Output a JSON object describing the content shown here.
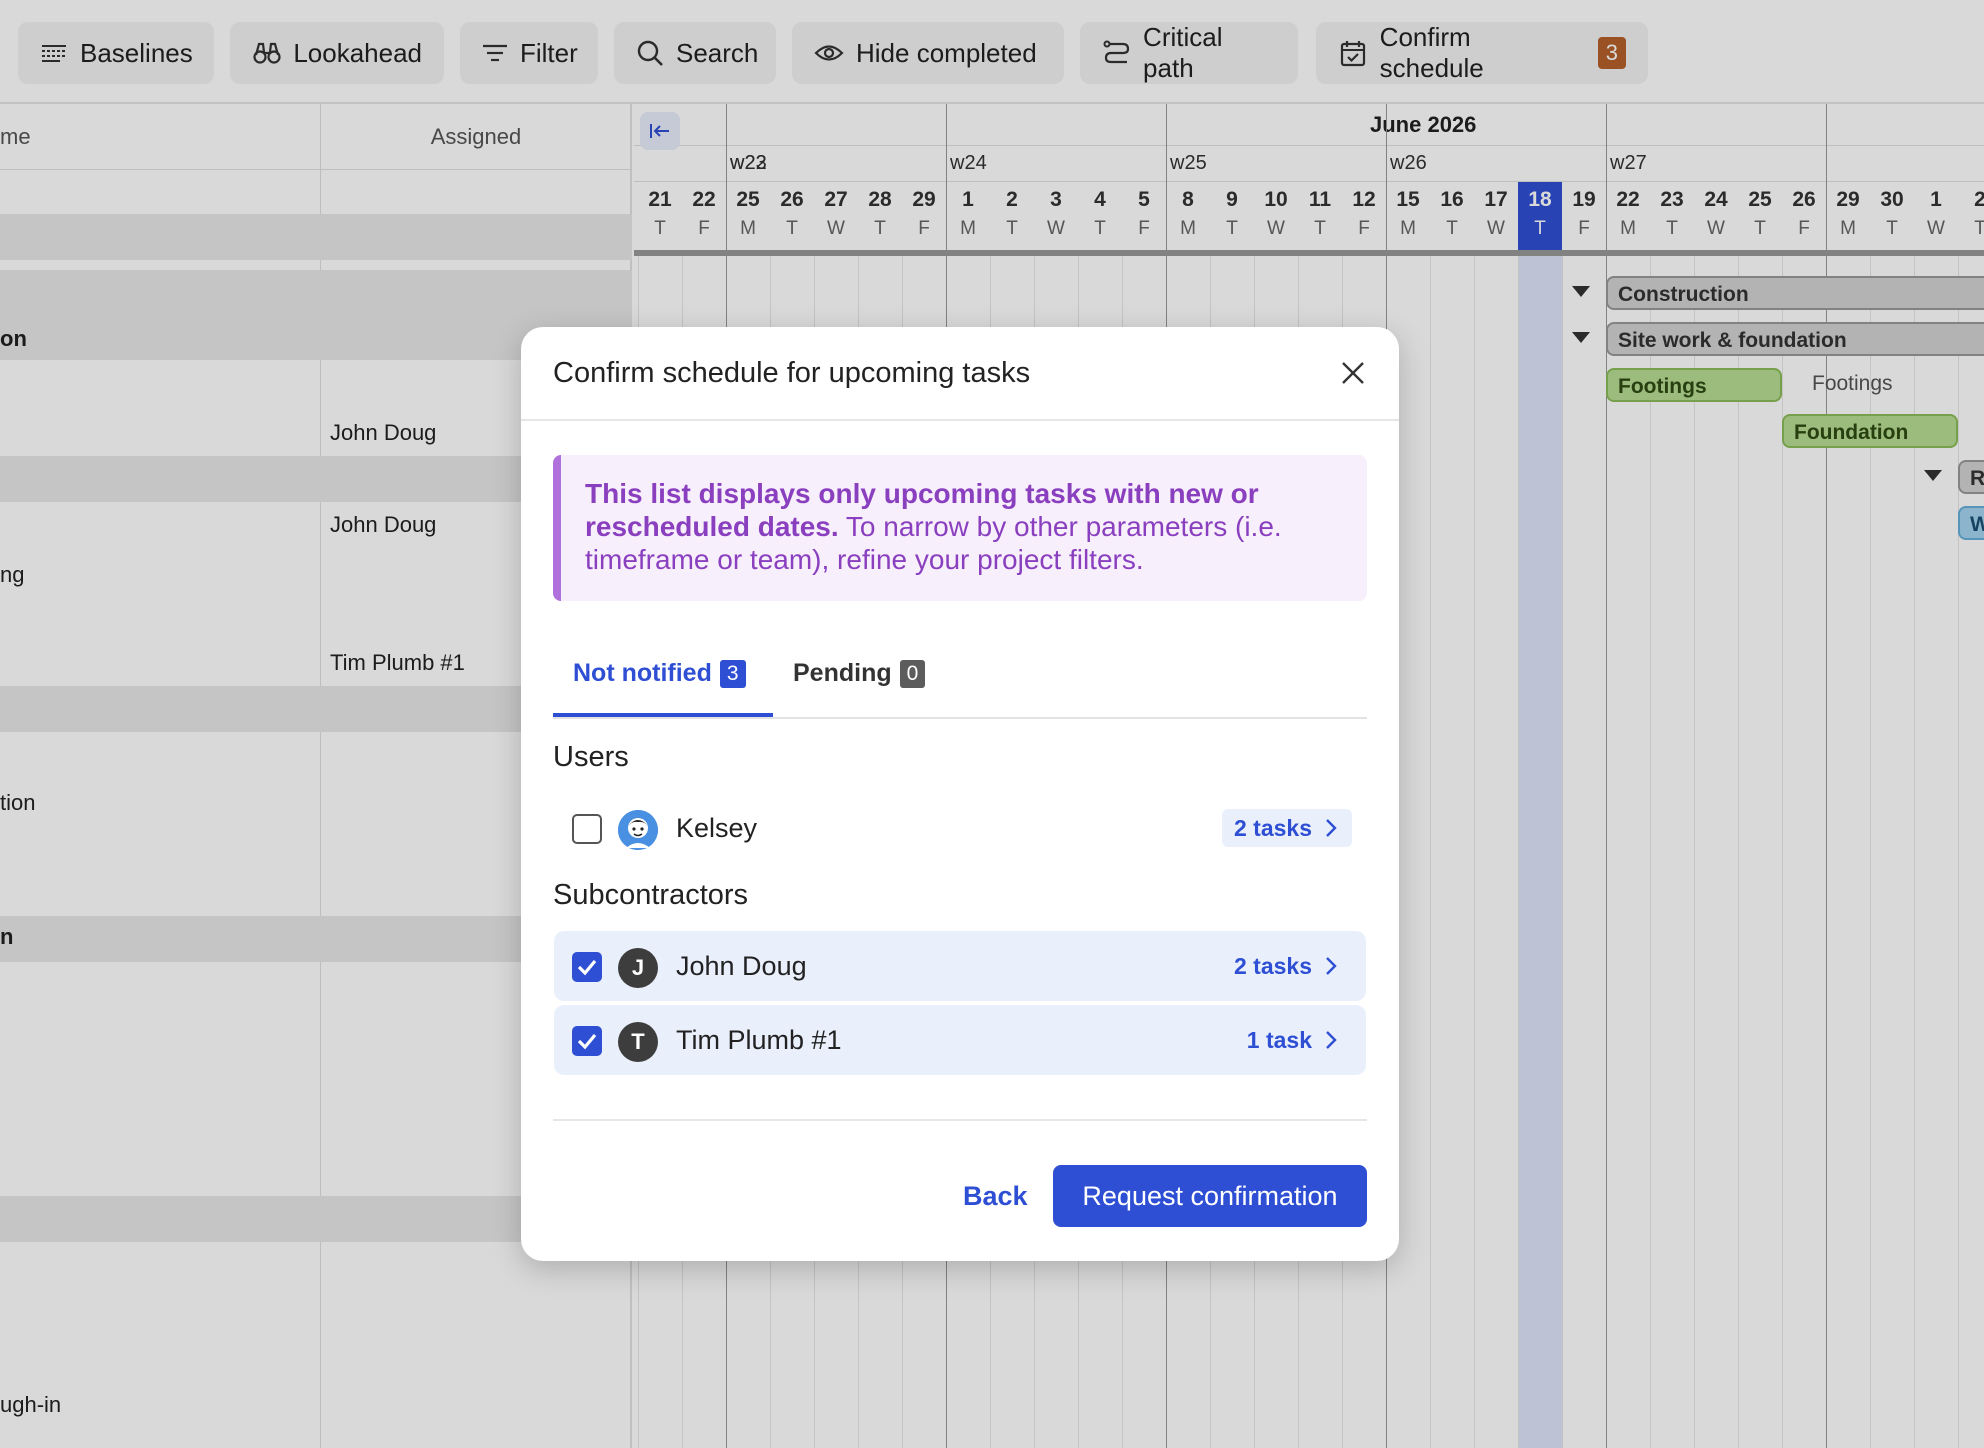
{
  "toolbar": {
    "buttons": [
      {
        "label": "Baselines",
        "icon": "baselines-icon"
      },
      {
        "label": "Lookahead",
        "icon": "binoculars-icon"
      },
      {
        "label": "Filter",
        "icon": "filter-icon"
      },
      {
        "label": "Search",
        "icon": "search-icon"
      },
      {
        "label": "Hide completed",
        "icon": "eye-icon"
      },
      {
        "label": "Critical path",
        "icon": "critical-path-icon"
      },
      {
        "label": "Confirm schedule",
        "icon": "calendar-check-icon",
        "badge": "3"
      }
    ]
  },
  "grid": {
    "col_name_header": "me",
    "col_assigned_header": "Assigned",
    "rows": [
      {
        "name": "on",
        "assigned": ""
      },
      {
        "name": "",
        "assigned": "John Doug"
      },
      {
        "name": "",
        "assigned": "John Doug"
      },
      {
        "name": "ng",
        "assigned": ""
      },
      {
        "name": "",
        "assigned": "Tim Plumb #1"
      },
      {
        "name": "tion",
        "assigned": ""
      },
      {
        "name": "n",
        "assigned": ""
      },
      {
        "name": "ugh-in",
        "assigned": ""
      }
    ]
  },
  "gantt": {
    "month": "June 2026",
    "weeks": [
      "w22",
      "w23",
      "w24",
      "w25",
      "w26",
      "w27"
    ],
    "days": [
      {
        "n": "21",
        "w": "T"
      },
      {
        "n": "22",
        "w": "F"
      },
      {
        "n": "25",
        "w": "M"
      },
      {
        "n": "26",
        "w": "T"
      },
      {
        "n": "27",
        "w": "W"
      },
      {
        "n": "28",
        "w": "T"
      },
      {
        "n": "29",
        "w": "F"
      },
      {
        "n": "1",
        "w": "M"
      },
      {
        "n": "2",
        "w": "T"
      },
      {
        "n": "3",
        "w": "W"
      },
      {
        "n": "4",
        "w": "T"
      },
      {
        "n": "5",
        "w": "F"
      },
      {
        "n": "8",
        "w": "M"
      },
      {
        "n": "9",
        "w": "T"
      },
      {
        "n": "10",
        "w": "W"
      },
      {
        "n": "11",
        "w": "T"
      },
      {
        "n": "12",
        "w": "F"
      },
      {
        "n": "15",
        "w": "M"
      },
      {
        "n": "16",
        "w": "T"
      },
      {
        "n": "17",
        "w": "W"
      },
      {
        "n": "18",
        "w": "T"
      },
      {
        "n": "19",
        "w": "F"
      },
      {
        "n": "22",
        "w": "M"
      },
      {
        "n": "23",
        "w": "T"
      },
      {
        "n": "24",
        "w": "W"
      },
      {
        "n": "25",
        "w": "T"
      },
      {
        "n": "26",
        "w": "F"
      },
      {
        "n": "29",
        "w": "M"
      },
      {
        "n": "30",
        "w": "T"
      },
      {
        "n": "1",
        "w": "W"
      },
      {
        "n": "2",
        "w": "T"
      }
    ],
    "today_index": 20,
    "bars": {
      "construction": "Construction",
      "site_work": "Site work & foundation",
      "footings": "Footings",
      "footings_label": "Footings",
      "foundation": "Foundation",
      "r_partial": "R",
      "w_partial": "W"
    }
  },
  "modal": {
    "title": "Confirm schedule for upcoming tasks",
    "notice_bold": "This list displays only upcoming tasks with new or rescheduled dates.",
    "notice_rest": " To narrow by other parameters (i.e. timeframe or team), refine your project filters.",
    "tabs": [
      {
        "label": "Not notified",
        "count": "3"
      },
      {
        "label": "Pending",
        "count": "0"
      }
    ],
    "users_title": "Users",
    "users": [
      {
        "name": "Kelsey",
        "tasks": "2 tasks",
        "checked": false
      }
    ],
    "subs_title": "Subcontractors",
    "subcontractors": [
      {
        "name": "John Doug",
        "initial": "J",
        "tasks": "2 tasks",
        "checked": true
      },
      {
        "name": "Tim Plumb #1",
        "initial": "T",
        "tasks": "1 task",
        "checked": true
      }
    ],
    "back_label": "Back",
    "primary_label": "Request confirmation"
  },
  "colors": {
    "accent": "#2e4fd4",
    "notice_text": "#8a3fbf",
    "badge_orange": "#b5602a"
  }
}
